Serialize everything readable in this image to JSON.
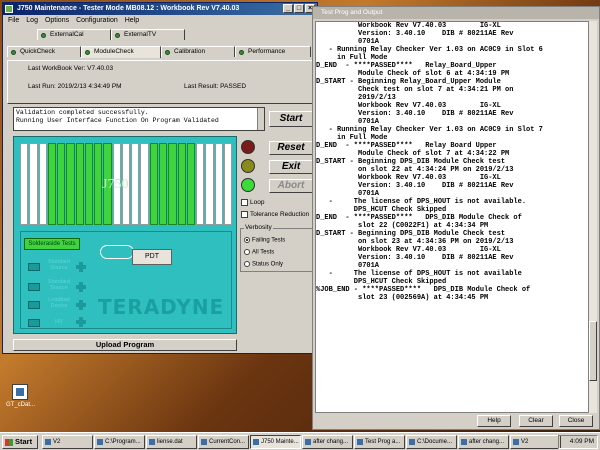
{
  "main_window": {
    "title": "J750 Maintenance - Tester Mode    MB08.12 : Workbook Rev V7.40.03",
    "menu": [
      "File",
      "Log",
      "Options",
      "Configuration",
      "Help"
    ],
    "tabs_row1": [
      "ExternalCal",
      "ExternalTV"
    ],
    "tabs_row2": [
      "QuickCheck",
      "ModuleCheck",
      "Calibration",
      "Performance"
    ],
    "info": {
      "last_workbook": "Last WorkBook Ver: V7.40.03",
      "last_run": "Last Run: 2019/2/13 4:34:49 PM",
      "last_result": "Last Result: PASSED"
    },
    "messages": [
      "Validation completed successfully.",
      "Running User Interface Function On Program Validated"
    ],
    "buttons": {
      "start": "Start",
      "reset": "Reset",
      "exit": "Exit",
      "abort": "Abort",
      "upload": "Upload Program"
    },
    "board": {
      "logo": "J750",
      "brand": "TERADYNE",
      "smt_button": "Solderaside Tests",
      "pdt": "PDT",
      "side_labels": [
        "Standard Source",
        "Standard Source",
        "Loadbad Device",
        "HV"
      ]
    },
    "checks": {
      "loop": "Loop",
      "tolerance": "Tolerance Reduction"
    },
    "verbosity": {
      "label": "Verbosity",
      "options": [
        "Failing Tests",
        "All Tests",
        "Status Only"
      ],
      "selected": "Failing Tests"
    },
    "lights": {
      "red": "#7a1a1a",
      "yellow": "#8a8a1a",
      "green": "#3adc3a"
    }
  },
  "log_window": {
    "title": "Test Prog and Output",
    "lines": [
      "          Workbook Rev V7.40.03        IG-XL",
      "          Version: 3.40.10    DIB # 80211AE Rev",
      "          0701A",
      "",
      "   - Running Relay Checker Ver 1.03 on AC0C9 in Slot 6",
      "     in Full Mode",
      "",
      "D_END  - ****PASSED****   Relay_Board_Upper",
      "          Module Check of slot 6 at 4:34:19 PM",
      "",
      "D_START - Beginning Relay_Board_Upper Module",
      "          Check test on slot 7 at 4:34:21 PM on",
      "          2019/2/13",
      "          Workbook Rev V7.40.03        IG-XL",
      "          Version: 3.40.10    DIB # 80211AE Rev",
      "          0701A",
      "",
      "   - Running Relay Checker Ver 1.03 on AC0C9 in Slot 7",
      "     in Full Mode",
      "",
      "D_END  - ****PASSED****   Relay Board Upper",
      "          Module Check of slot 7 at 4:34:22 PM",
      "",
      "D_START - Beginning DPS_DIB Module Check test",
      "          on slot 22 at 4:34:24 PM on 2019/2/13",
      "          Workbook Rev V7.40.03        IG-XL",
      "          Version: 3.40.10    DIB # 80211AE Rev",
      "          0701A",
      "",
      "   -     The license of DPS_HOUT is not available.",
      "         DPS_HCUT Check Skipped",
      "",
      "D_END  - ****PASSED****   DPS_DIB Module Check of",
      "          slot 22 (C0022F1) at 4:34:34 PM",
      "",
      "D_START - Beginning DPS_DIB Module Check test",
      "          on slot 23 at 4:34:36 PM on 2019/2/13",
      "          Workbook Rev V7.40.03        IG-XL",
      "          Version: 3.40.10    DIB # 80211AE Rev",
      "          0701A",
      "",
      "   -     The license of DPS_HOUT is not available",
      "         DPS_HCUT Check Skipped",
      "",
      "%JOB_END - ****PASSED****   DPS_DIB Module Check of",
      "          slot 23 (002569A) at 4:34:45 PM"
    ],
    "buttons": [
      "Help",
      "Clear",
      "Close"
    ]
  },
  "desktop": {
    "icon_label": "GT_cDat..."
  },
  "taskbar": {
    "start": "Start",
    "items": [
      "V2",
      "C:\\Program...",
      "liense.dat",
      "CurrentCon...",
      "J750 Mainte...",
      "after chang...",
      "Test Prog a...",
      "C:\\Docume...",
      "after chang...",
      "V2"
    ],
    "active_index": 4,
    "clock": "4:09 PM"
  }
}
